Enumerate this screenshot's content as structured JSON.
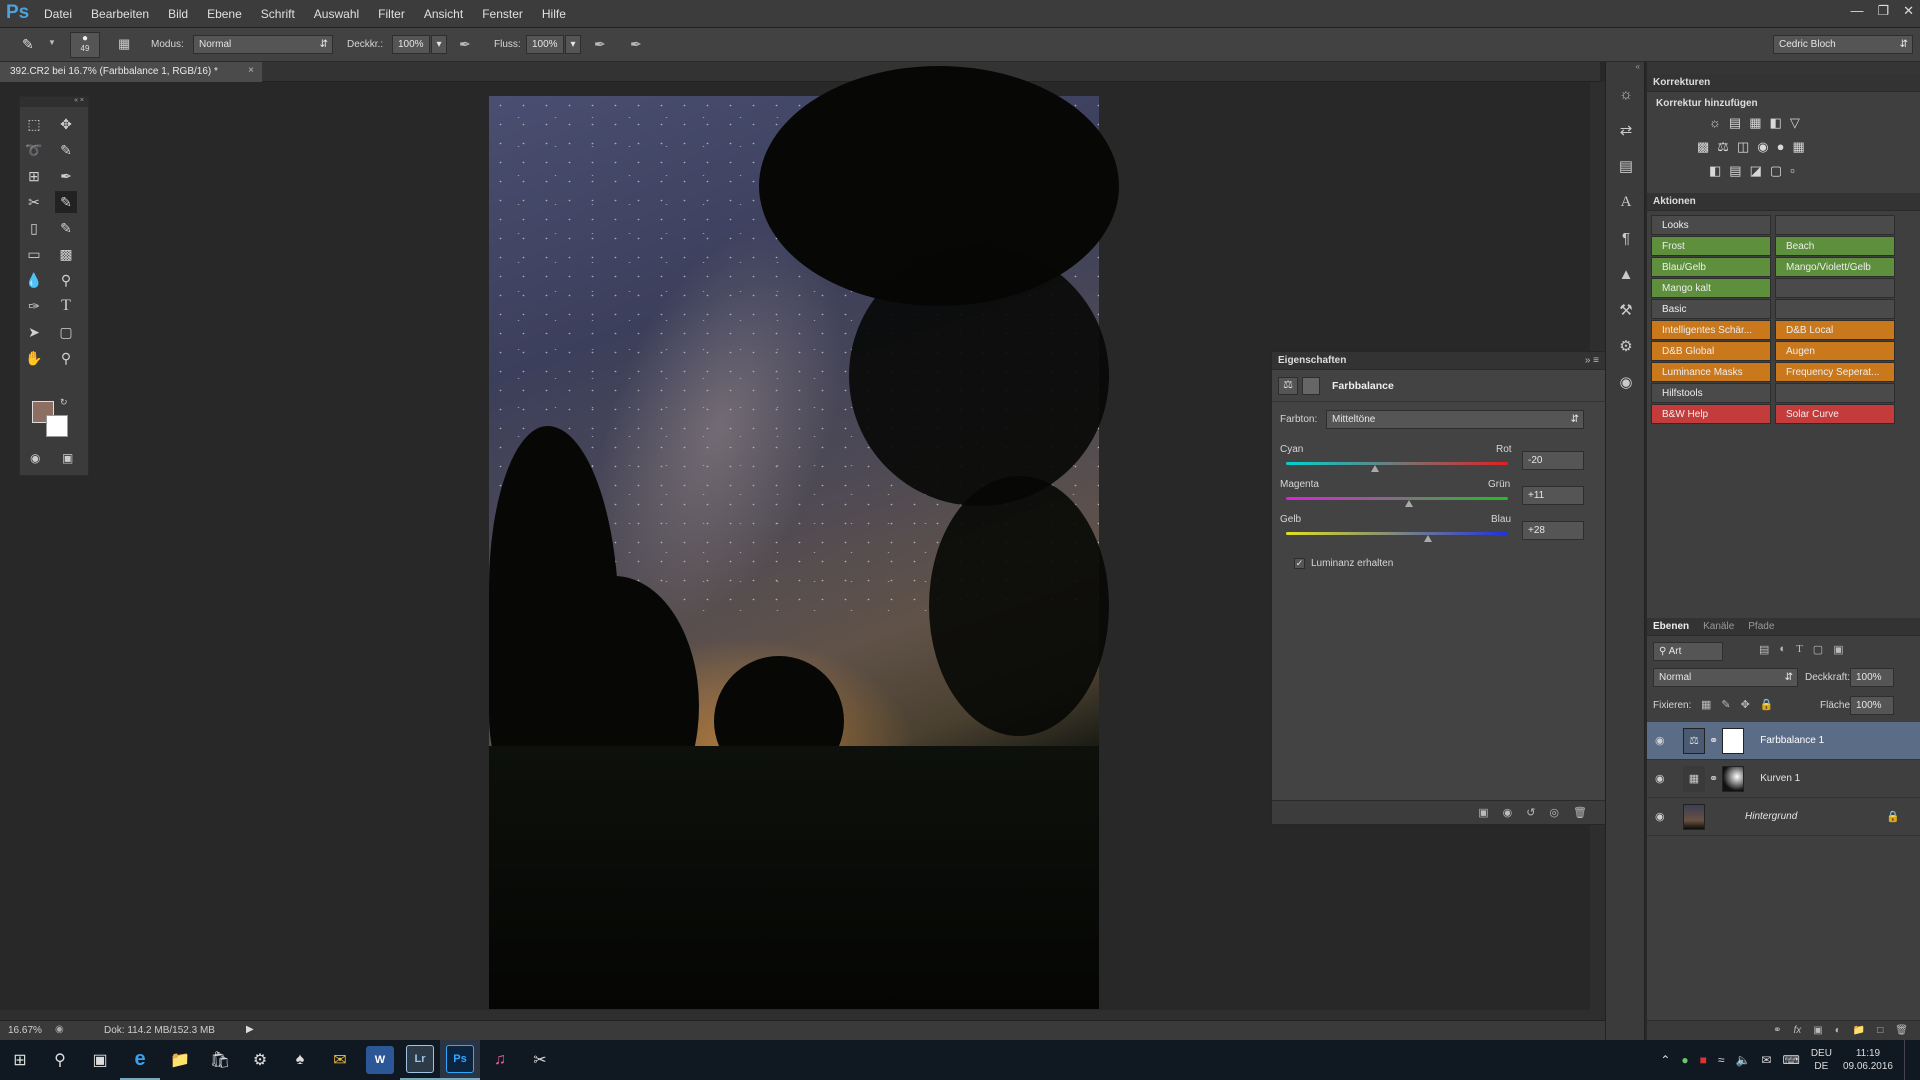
{
  "app": {
    "logo": "Ps"
  },
  "menu": [
    "Datei",
    "Bearbeiten",
    "Bild",
    "Ebene",
    "Schrift",
    "Auswahl",
    "Filter",
    "Ansicht",
    "Fenster",
    "Hilfe"
  ],
  "options": {
    "brush_size": "49",
    "mode_label": "Modus:",
    "mode_value": "Normal",
    "opacity_label": "Deckkr.:",
    "opacity_value": "100%",
    "flow_label": "Fluss:",
    "flow_value": "100%",
    "workspace": "Cedric Bloch"
  },
  "document": {
    "tab_title": "392.CR2 bei 16.7% (Farbbalance 1, RGB/16) *",
    "zoom": "16.67%",
    "doc_info": "Dok: 114.2 MB/152.3 MB"
  },
  "properties": {
    "panel_title": "Eigenschaften",
    "adjustment": "Farbbalance",
    "tone_label": "Farbton:",
    "tone_value": "Mitteltöne",
    "sliders": [
      {
        "left": "Cyan",
        "right": "Rot",
        "value": "-20",
        "level": -20
      },
      {
        "left": "Magenta",
        "right": "Grün",
        "value": "+11",
        "level": 11
      },
      {
        "left": "Gelb",
        "right": "Blau",
        "value": "+28",
        "level": 28
      }
    ],
    "preserve_luminosity": "Luminanz erhalten"
  },
  "corrections": {
    "title": "Korrekturen",
    "subtitle": "Korrektur hinzufügen"
  },
  "actions": {
    "title": "Aktionen",
    "rows": [
      {
        "a": "Looks",
        "b": "",
        "color": "#4a4a4a"
      },
      {
        "a": "Frost",
        "b": "Beach",
        "color": "#5d8f3c"
      },
      {
        "a": "Blau/Gelb",
        "b": "Mango/Violett/Gelb",
        "color": "#5d8f3c"
      },
      {
        "a": "Mango kalt",
        "b": "",
        "color": "#5d8f3c"
      },
      {
        "a": "Basic",
        "b": "",
        "color": "#4a4a4a"
      },
      {
        "a": "Intelligentes Schär...",
        "b": "D&B Local",
        "color": "#c9781c"
      },
      {
        "a": "D&B Global",
        "b": "Augen",
        "color": "#c9781c"
      },
      {
        "a": "Luminance Masks",
        "b": "Frequency Seperat...",
        "color": "#c9781c"
      },
      {
        "a": "Hilfstools",
        "b": "",
        "color": "#4a4a4a"
      },
      {
        "a": "B&W Help",
        "b": "Solar Curve",
        "color": "#c33b3b"
      }
    ]
  },
  "layers": {
    "tabs": [
      "Ebenen",
      "Kanäle",
      "Pfade"
    ],
    "filter": "Art",
    "blend": "Normal",
    "opacity_label": "Deckkraft:",
    "opacity_value": "100%",
    "lock_label": "Fixieren:",
    "fill_label": "Fläche:",
    "fill_value": "100%",
    "items": [
      {
        "name": "Farbbalance 1"
      },
      {
        "name": "Kurven 1"
      },
      {
        "name": "Hintergrund"
      }
    ]
  },
  "taskbar": {
    "time": "11:19",
    "date": "09.06.2016",
    "lang1": "DEU",
    "lang2": "DE"
  }
}
